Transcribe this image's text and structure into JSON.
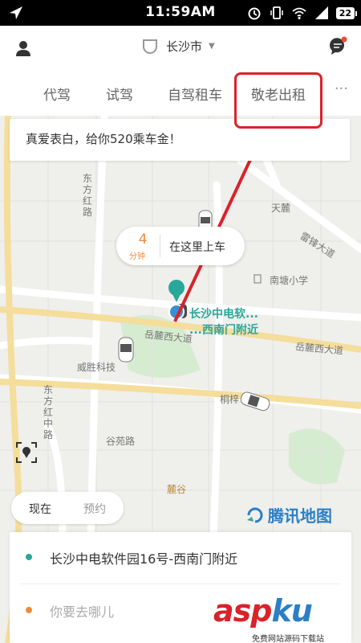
{
  "status_bar": {
    "time": "11:59AM",
    "battery": "22",
    "icons": [
      "location-arrow-icon",
      "alarm-icon",
      "vibrate-icon",
      "wifi-icon",
      "signal-icon",
      "battery-icon"
    ]
  },
  "header": {
    "city": "长沙市",
    "icons": [
      "user-icon",
      "didi-logo-icon",
      "message-icon"
    ],
    "notification_dot_color": "#f04a3a"
  },
  "tabs": {
    "items": [
      {
        "label": "代驾"
      },
      {
        "label": "试驾"
      },
      {
        "label": "自驾租车"
      },
      {
        "label": "敬老出租"
      }
    ],
    "more": "···"
  },
  "promo": {
    "text": "真爱表白，给你520乘车金！"
  },
  "pickup": {
    "eta_value": "4",
    "eta_unit": "分钟",
    "label": "在这里上车"
  },
  "destination_label": {
    "line1": "长沙中电软...",
    "line2": "...西南门附近"
  },
  "map_labels": {
    "dongfanghonglu": "东方红路",
    "tianlu": "天麓",
    "leifeng": "雷锋大道",
    "nanlu_school": "南塘小学",
    "yuelu_west": "岳麓西大道",
    "yuelu_west_2": "岳麓西大道",
    "weisheng": "威胜科技",
    "dongfanghongzhong": "东方红中路",
    "gurong": "谷苑路",
    "tongyuan": "桐梓",
    "lugu": "麓谷"
  },
  "toggle": {
    "now": "现在",
    "book": "预约"
  },
  "brand": "腾讯地图",
  "trip": {
    "from": "长沙中电软件园16号-西南门附近",
    "to_placeholder": "你要去哪儿"
  },
  "watermark": {
    "asp": "asp",
    "ku": "ku",
    "sub": "免费网站源码下载站"
  },
  "colors": {
    "accent_teal": "#2aa79a",
    "accent_orange": "#f08a3a",
    "highlight_red": "#d9232a",
    "brand_blue": "#2a7fc7"
  }
}
